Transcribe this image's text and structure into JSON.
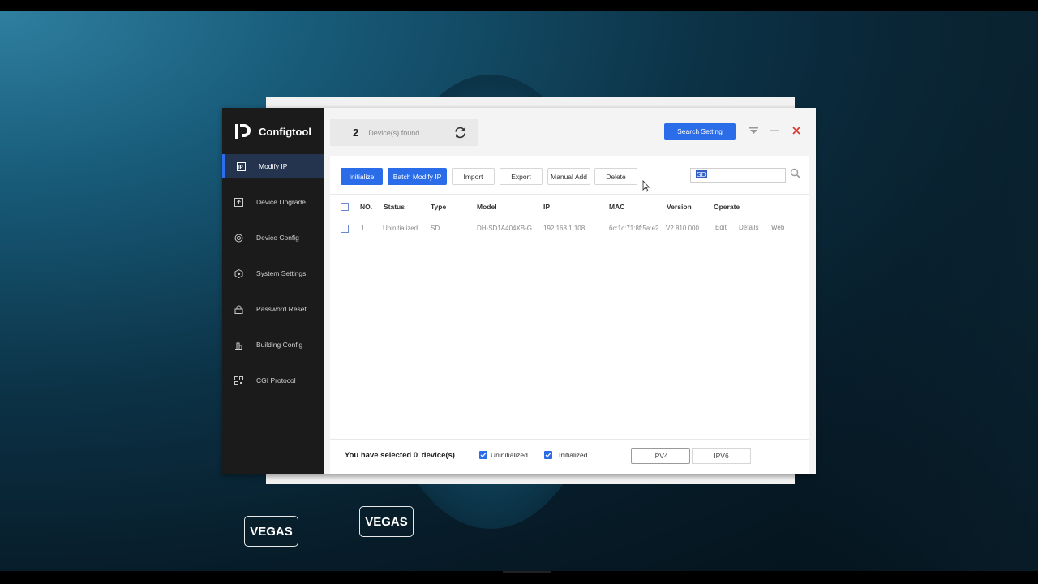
{
  "app": {
    "name": "Configtool"
  },
  "sidebar": {
    "items": [
      {
        "label": "Modify IP",
        "icon": "ip-icon",
        "active": true
      },
      {
        "label": "Device Upgrade",
        "icon": "upgrade-icon",
        "active": false
      },
      {
        "label": "Device Config",
        "icon": "config-icon",
        "active": false
      },
      {
        "label": "System Settings",
        "icon": "settings-icon",
        "active": false
      },
      {
        "label": "Password Reset",
        "icon": "lock-icon",
        "active": false
      },
      {
        "label": "Building Config",
        "icon": "building-icon",
        "active": false
      },
      {
        "label": "CGI Protocol",
        "icon": "qr-icon",
        "active": false
      }
    ]
  },
  "header": {
    "device_count": "2",
    "device_label": "Device(s) found",
    "search_setting_label": "Search Setting"
  },
  "toolbar": {
    "initialize": "Initialize",
    "batch_modify_ip": "Batch Modify IP",
    "import": "Import",
    "export": "Export",
    "manual_add": "Manual Add",
    "delete": "Delete"
  },
  "search": {
    "value": "SD"
  },
  "table": {
    "columns": [
      "NO.",
      "Status",
      "Type",
      "Model",
      "IP",
      "MAC",
      "Version",
      "Operate"
    ],
    "rows": [
      {
        "no": "1",
        "status": "Uninitialized",
        "type": "SD",
        "model": "DH-SD1A404XB-G...",
        "ip": "192.168.1.108",
        "mac": "6c:1c:71:8f:5a:e2",
        "version": "V2.810.000...",
        "ops": [
          "Edit",
          "Details",
          "Web"
        ]
      }
    ]
  },
  "footer": {
    "selected_prefix": "You have selected",
    "selected_count": "0",
    "selected_suffix": "device(s)",
    "filter_uninitialized": "Uninitialized",
    "filter_initialized": "Initialized",
    "tab_ipv4": "IPV4",
    "tab_ipv6": "IPV6"
  },
  "overlay": {
    "badge1": "VEGAS",
    "badge2": "VEGAS"
  },
  "colors": {
    "accent": "#2b6ce8",
    "sidebar_bg": "#1b1b1b",
    "close": "#d9342b"
  }
}
